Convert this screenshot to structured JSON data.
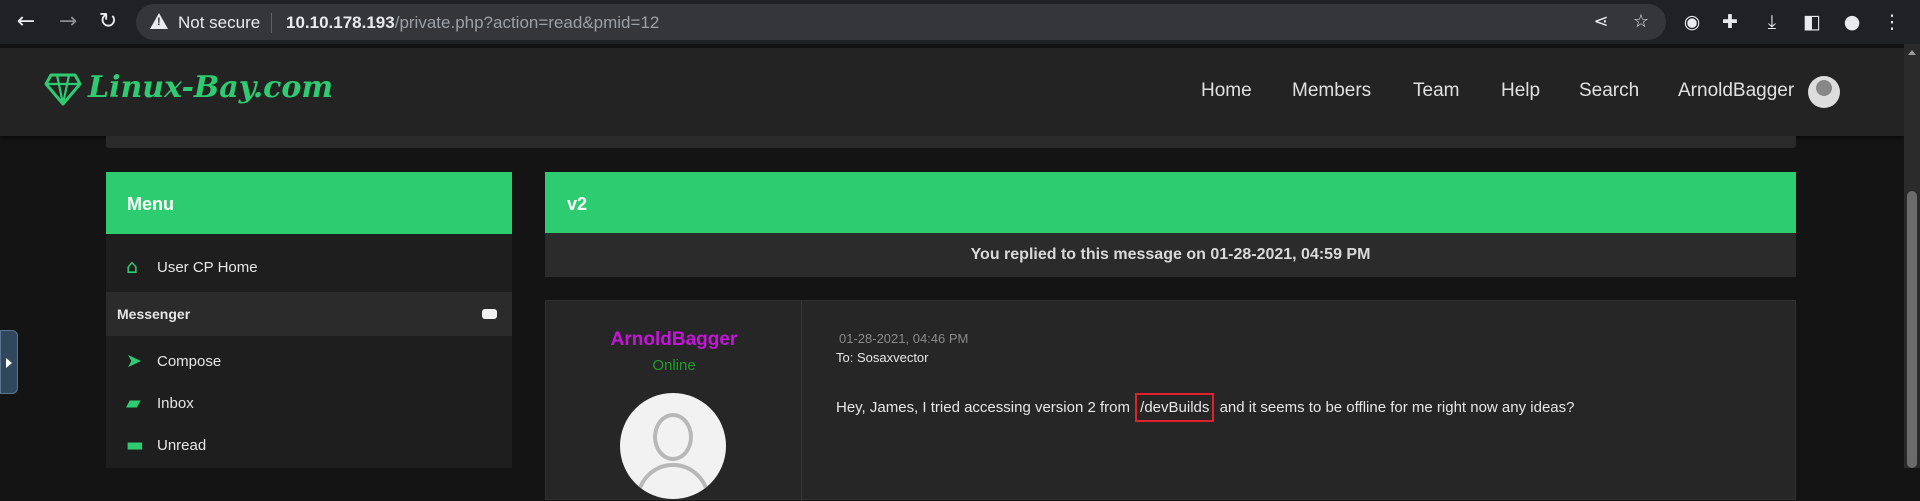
{
  "browser": {
    "security_label": "Not secure",
    "url_host": "10.10.178.193",
    "url_path": "/private.php?action=read&pmid=12",
    "icons": [
      "back-icon",
      "forward-icon",
      "reload-icon",
      "share-icon",
      "star-icon",
      "extension-circle-icon",
      "puzzle-icon",
      "download-icon",
      "side-panel-icon",
      "profile-icon",
      "kebab-menu-icon"
    ]
  },
  "site": {
    "logo_text": "Linux-Bay.com",
    "brand_color": "#2ecc71",
    "nav": {
      "home": "Home",
      "members": "Members",
      "team": "Team",
      "help": "Help",
      "search": "Search",
      "user": "ArnoldBagger"
    }
  },
  "sidebar": {
    "title": "Menu",
    "usercp": "User CP Home",
    "section": "Messenger",
    "compose": "Compose",
    "inbox": "Inbox",
    "unread": "Unread"
  },
  "message": {
    "subject": "v2",
    "reply_notice": "You replied to this message on 01-28-2021, 04:59 PM",
    "author": "ArnoldBagger",
    "author_color": "#c515d9",
    "status": "Online",
    "date": "01-28-2021, 04:46 PM",
    "to": "To: Sosaxvector",
    "body_before": "Hey, James, I tried accessing version 2 from",
    "body_highlight": "/devBuilds",
    "body_after": "and it seems to be offline for me right now any ideas?"
  }
}
